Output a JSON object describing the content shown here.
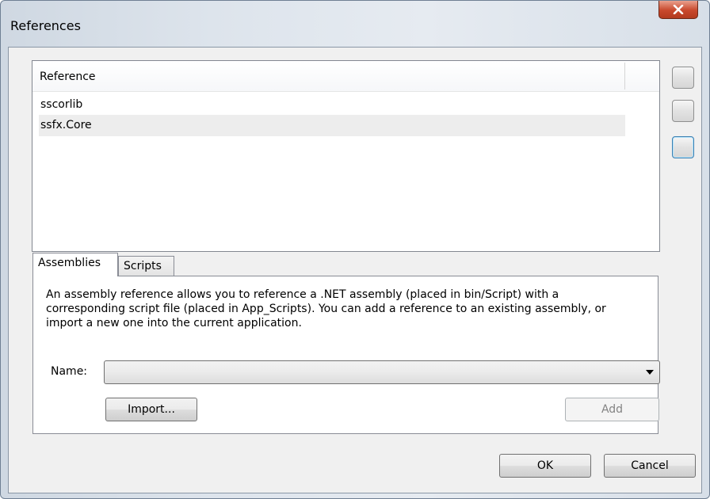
{
  "window": {
    "title": "References"
  },
  "reference_list": {
    "column_header": "Reference",
    "items": [
      "sscorlib",
      "ssfx.Core"
    ]
  },
  "tabs": [
    {
      "label": "Assemblies",
      "active": true
    },
    {
      "label": "Scripts",
      "active": false
    }
  ],
  "assemblies_panel": {
    "description_lines": [
      "An assembly reference allows you to reference a .NET assembly (placed in bin/Script) with a",
      "corresponding script file (placed in App_Scripts). You can add a reference to an existing assembly, or",
      "import a new one into the current application."
    ],
    "name_label": "Name:",
    "name_value": "",
    "import_button": "Import...",
    "add_button": "Add"
  },
  "footer": {
    "ok_button": "OK",
    "cancel_button": "Cancel"
  },
  "icons": {
    "close": "close-x-icon",
    "dropdown": "chevron-down-icon"
  },
  "colors": {
    "close_button": "#c8482c",
    "selected_row": "#ededed",
    "focus_border": "#3c7fb1"
  }
}
